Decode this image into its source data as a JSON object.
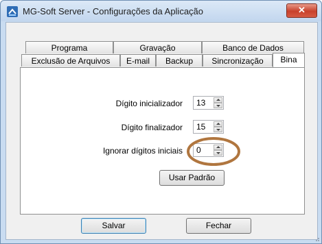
{
  "window": {
    "title": "MG-Soft Server - Configurações da Aplicação",
    "close_label": "✕"
  },
  "tabs": {
    "row1": [
      "Programa",
      "Gravação",
      "Banco de Dados"
    ],
    "row2": [
      "Exclusão de Arquivos",
      "E-mail",
      "Backup",
      "Sincronização",
      "Bina"
    ],
    "active": "Bina"
  },
  "bina": {
    "digito_inicializador": {
      "label": "Dígito inicializador",
      "value": "13"
    },
    "digito_finalizador": {
      "label": "Dígito finalizador",
      "value": "15"
    },
    "ignorar_digitos": {
      "label": "Ignorar dígitos iniciais",
      "value": "0"
    },
    "usar_padrao_label": "Usar Padrão"
  },
  "footer": {
    "salvar_label": "Salvar",
    "fechar_label": "Fechar"
  },
  "colors": {
    "highlight_circle": "#b0763f",
    "window_frame": "#c9dcf1",
    "close_button": "#c8412c"
  },
  "icons": {
    "app_icon": "app-icon",
    "close": "close-icon",
    "spin_up": "spin-up-arrow-icon",
    "spin_down": "spin-down-arrow-icon",
    "resize_grip": "resize-grip-icon"
  }
}
